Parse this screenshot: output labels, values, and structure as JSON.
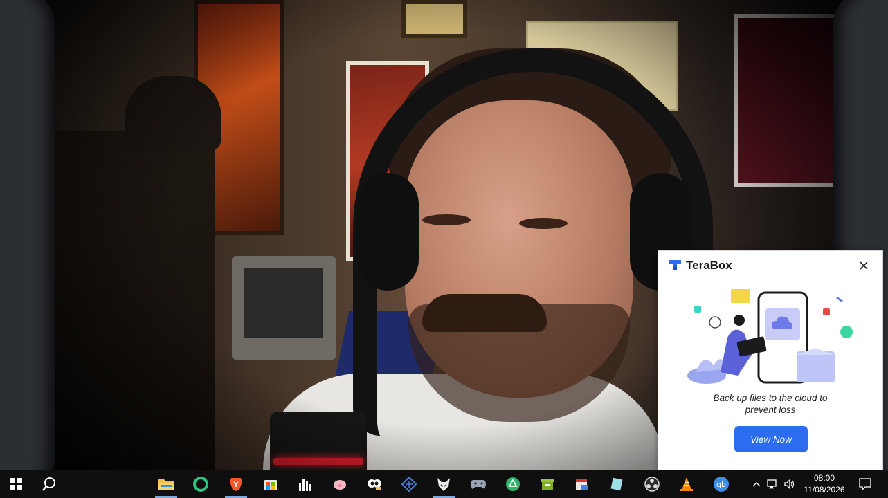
{
  "notification": {
    "brand": "TeraBox",
    "message": "Back up files to the cloud to prevent loss",
    "cta_label": "View Now",
    "accent_color": "#2b6cf0"
  },
  "taskbar": {
    "pinned": [
      {
        "name": "start-button",
        "icon": "windows-logo-icon"
      },
      {
        "name": "search-button",
        "icon": "search-icon"
      },
      {
        "name": "file-explorer",
        "icon": "folder-icon",
        "active": true
      },
      {
        "name": "opera-gx",
        "icon": "opera-icon"
      },
      {
        "name": "brave-browser",
        "icon": "brave-lion-icon",
        "active": true
      },
      {
        "name": "microsoft-store",
        "icon": "store-bag-icon"
      },
      {
        "name": "audio-equalizer",
        "icon": "equalizer-bars-icon"
      },
      {
        "name": "pig-app",
        "icon": "pig-icon"
      },
      {
        "name": "clipboard-app",
        "icon": "cartoon-face-icon"
      },
      {
        "name": "network-app",
        "icon": "diamond-grid-icon"
      },
      {
        "name": "fox-app",
        "icon": "fox-icon",
        "active": true
      },
      {
        "name": "game-controller",
        "icon": "gamepad-icon"
      },
      {
        "name": "recycle-app",
        "icon": "recycle-triangle-icon"
      },
      {
        "name": "archive-app",
        "icon": "green-bin-icon"
      },
      {
        "name": "calendar-app",
        "icon": "calendar-icon"
      },
      {
        "name": "notes-app",
        "icon": "tilted-note-icon"
      },
      {
        "name": "obs-studio",
        "icon": "obs-icon"
      },
      {
        "name": "vlc-player",
        "icon": "traffic-cone-icon"
      },
      {
        "name": "qbittorrent",
        "icon": "qb-icon"
      }
    ],
    "tray": {
      "clock_time": "08:00",
      "clock_date": "11/08/2026"
    }
  }
}
